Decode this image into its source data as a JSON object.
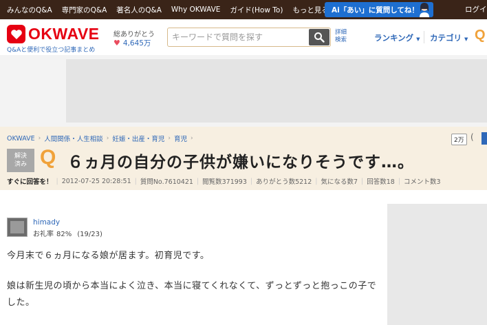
{
  "topnav": {
    "items": [
      "みんなのQ&A",
      "専門家のQ&A",
      "著名人のQ&A",
      "Why OKWAVE",
      "ガイド(How To)"
    ],
    "more": "もっと見る",
    "ai_button": "Ai「あい」に質問してね！",
    "login": "ログイ"
  },
  "header": {
    "logo": "OKWAVE",
    "tagline": "Q&Aと便利で役立つ記事まとめ",
    "thanks_label": "総ありがとう",
    "thanks_count": "4,645万",
    "search_placeholder": "キーワードで質問を探す",
    "advanced_search_line1": "詳細",
    "advanced_search_line2": "検索",
    "ranking": "ランキング",
    "category": "カテゴリ",
    "q_edge": "Q"
  },
  "breadcrumb": [
    "OKWAVE",
    "人間関係・人生相談",
    "妊娠・出産・育児",
    "育児"
  ],
  "bookmark": {
    "count": "2万",
    "paren": "("
  },
  "question": {
    "solved_line1": "解決",
    "solved_line2": "済み",
    "q_mark": "Q",
    "title": "６ヵ月の自分の子供が嫌いになりそうです…。"
  },
  "meta": {
    "urgent": "すぐに回答を！",
    "datetime": "2012-07-25 20:28:51",
    "question_no": "質問No.7610421",
    "views": "閲覧数371993",
    "thanks": "ありがとう数5212",
    "watch": "気になる数7",
    "answers": "回答数18",
    "comments": "コメント数3"
  },
  "user": {
    "name": "himady",
    "stat_label": "お礼率",
    "stat_pct": "82%",
    "stat_ratio": "(19/23)"
  },
  "body": {
    "para1": "今月末で６ヵ月になる娘が居ます。初育児です。",
    "para2": "娘は新生児の頃から本当によく泣き、本当に寝てくれなくて、ずっとずっと抱っこの子でした。"
  }
}
